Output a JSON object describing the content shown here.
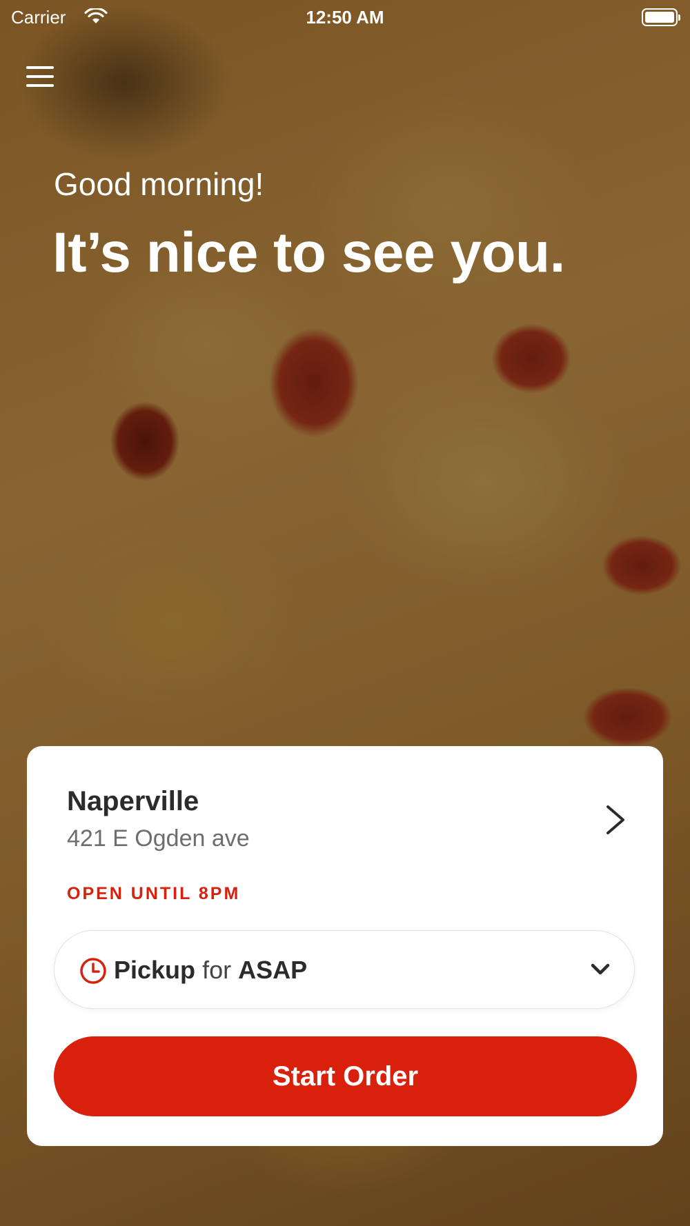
{
  "status_bar": {
    "carrier": "Carrier",
    "time": "12:50 AM",
    "icons": [
      "wifi-icon",
      "battery-icon"
    ]
  },
  "header": {
    "menu_icon": "hamburger-menu-icon"
  },
  "hero": {
    "greeting": "Good morning!",
    "headline": "It’s nice to see you.",
    "background": "pizza photo"
  },
  "location_card": {
    "name": "Naperville",
    "address": "421 E Ogden ave",
    "status": "OPEN UNTIL 8PM",
    "status_color": "#d9200d",
    "chevron_icon": "chevron-right-icon"
  },
  "order_mode": {
    "icon": "clock-icon",
    "mode": "Pickup",
    "connector": "for",
    "time": "ASAP",
    "dropdown_icon": "chevron-down-icon"
  },
  "cta": {
    "label": "Start Order",
    "color": "#d9200d"
  }
}
